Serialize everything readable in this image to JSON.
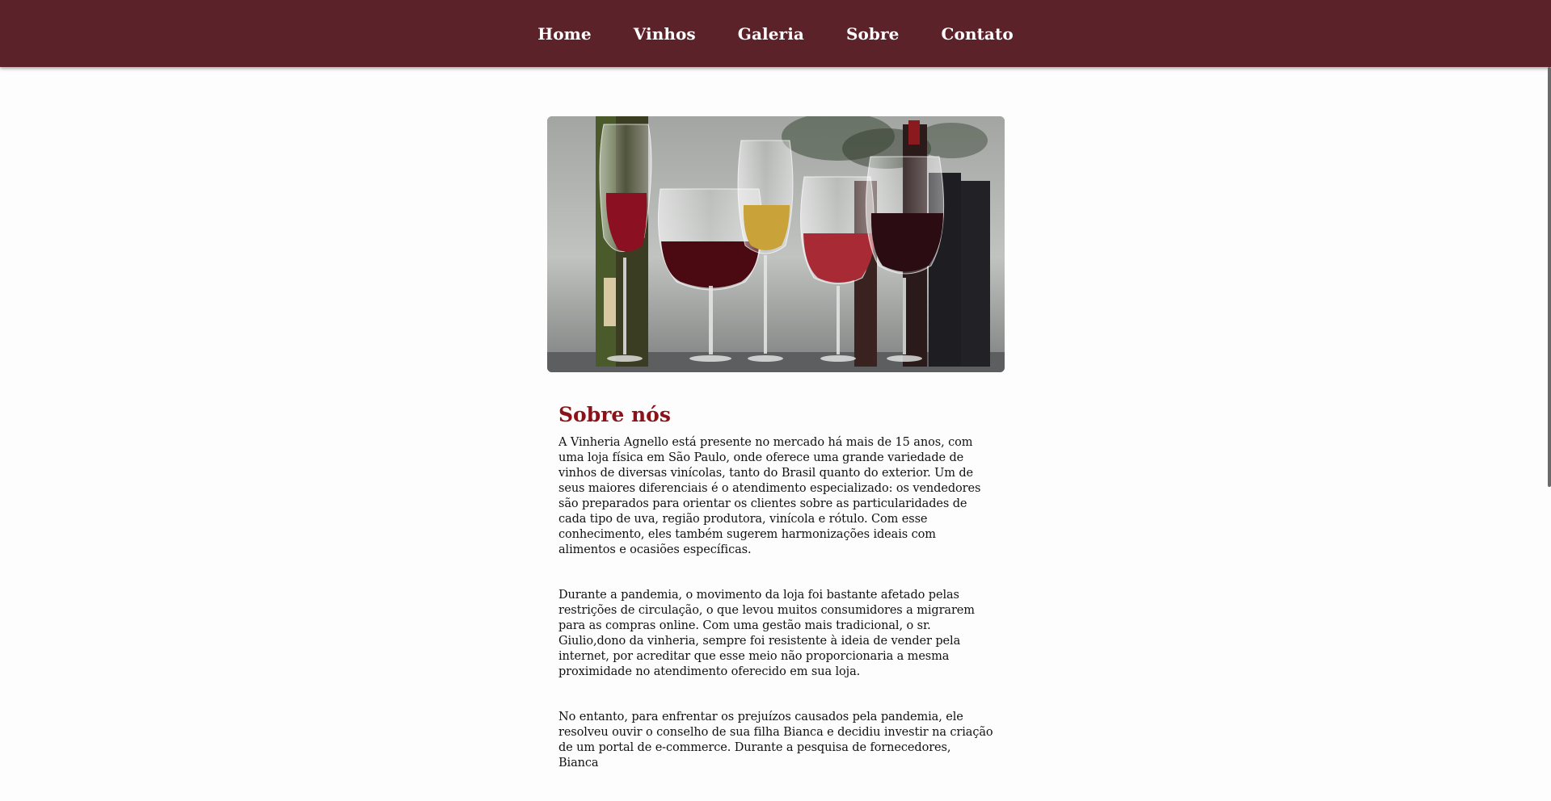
{
  "nav": {
    "items": [
      "Home",
      "Vinhos",
      "Galeria",
      "Sobre",
      "Contato"
    ]
  },
  "hero": {
    "alt": "Taças de vinho tinto, rosé e branco com garrafas ao fundo"
  },
  "about": {
    "title": "Sobre nós",
    "paragraphs": [
      "A Vinheria Agnello está presente no mercado há mais de 15 anos, com uma loja física em São Paulo, onde oferece uma grande variedade de vinhos de diversas vinícolas, tanto do Brasil quanto do exterior. Um de seus maiores diferenciais é o atendimento especializado: os vendedores são preparados para orientar os clientes sobre as particularidades de cada tipo de uva, região produtora, vinícola e rótulo. Com esse conhecimento, eles também sugerem harmonizações ideais com alimentos e ocasiões específicas.",
      "Durante a pandemia, o movimento da loja foi bastante afetado pelas restrições de circulação, o que levou muitos consumidores a migrarem para as compras online. Com uma gestão mais tradicional, o sr. Giulio,dono da vinheria, sempre foi resistente à ideia de vender pela internet, por acreditar que esse meio não proporcionaria a mesma proximidade no atendimento oferecido em sua loja.",
      "No entanto, para enfrentar os prejuízos causados pela pandemia, ele resolveu ouvir o conselho de sua filha Bianca e decidiu investir na criação de um portal de e-commerce. Durante a pesquisa de fornecedores, Bianca"
    ]
  },
  "colors": {
    "nav_bg": "#5b222a",
    "title": "#8b1218"
  }
}
